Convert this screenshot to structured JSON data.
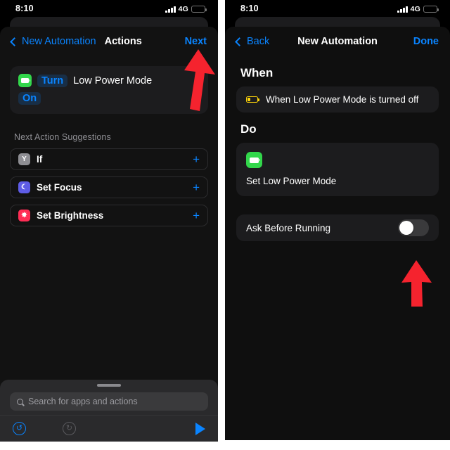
{
  "status_bar": {
    "time": "8:10",
    "network": "4G",
    "signal_icon": "cellular-bars-icon",
    "battery_icon": "battery-low-yellow-icon"
  },
  "left_phone": {
    "nav": {
      "back_label": "New Automation",
      "back_icon": "chevron-left-icon",
      "title": "Actions",
      "action_label": "Next"
    },
    "action_card": {
      "app_icon": "low-power-mode-battery-icon",
      "verb_chip": "Turn",
      "target_text": "Low Power Mode",
      "state_chip": "On"
    },
    "suggestions_header": "Next Action Suggestions",
    "suggestions": [
      {
        "label": "If",
        "icon": "if-branch-icon",
        "icon_glyph": "Y",
        "add_icon": "plus-icon"
      },
      {
        "label": "Set Focus",
        "icon": "focus-moon-icon",
        "icon_glyph": "☾",
        "add_icon": "plus-icon"
      },
      {
        "label": "Set Brightness",
        "icon": "brightness-sun-icon",
        "icon_glyph": "✸",
        "add_icon": "plus-icon"
      }
    ],
    "drawer": {
      "grabber_icon": "drag-grabber-icon",
      "search_icon": "search-icon",
      "search_placeholder": "Search for apps and actions",
      "undo_icon": "undo-icon",
      "undo_glyph": "↺",
      "redo_icon": "redo-icon",
      "redo_glyph": "↻",
      "run_icon": "play-run-icon"
    }
  },
  "right_phone": {
    "nav": {
      "back_label": "Back",
      "back_icon": "chevron-left-icon",
      "title": "New Automation",
      "action_label": "Done"
    },
    "when": {
      "heading": "When",
      "trigger_icon": "battery-low-yellow-icon",
      "trigger_text": "When Low Power Mode is turned off"
    },
    "do": {
      "heading": "Do",
      "action_icon": "low-power-mode-battery-icon",
      "action_label": "Set Low Power Mode"
    },
    "ask_before_running": {
      "label": "Ask Before Running",
      "toggle_icon": "toggle-switch-off",
      "toggle_state": "off"
    }
  },
  "annotations": {
    "arrow_color": "#f5232e",
    "arrows": [
      {
        "name": "arrow-pointing-to-next-button"
      },
      {
        "name": "arrow-pointing-to-ask-before-running-toggle"
      }
    ]
  },
  "theme": {
    "accent_blue": "#0a84ff",
    "green": "#32d74b",
    "yellow": "#ffd60a",
    "card_bg": "#1c1c1e",
    "screen_bg": "#000000"
  }
}
